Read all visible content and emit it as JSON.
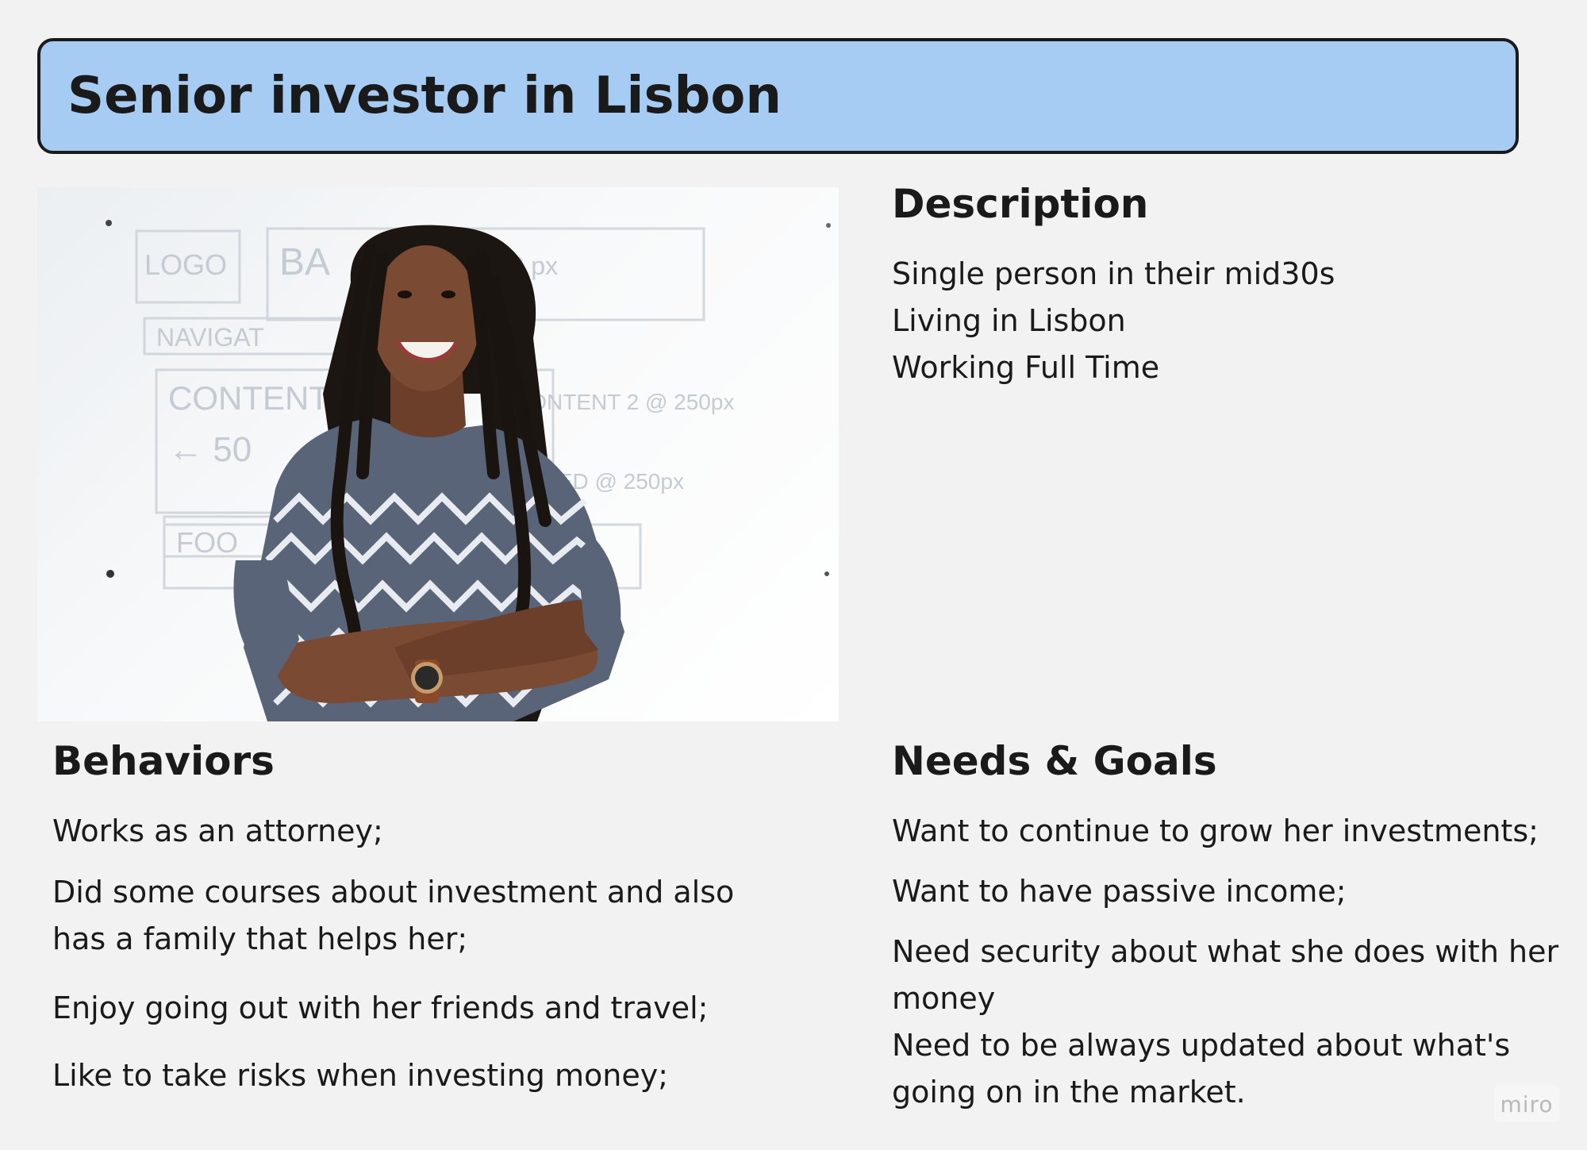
{
  "title": "Senior investor in Lisbon",
  "description": {
    "heading": "Description",
    "lines": [
      "Single person in their mid30s",
      "Living in Lisbon",
      "Working Full Time"
    ]
  },
  "behaviors": {
    "heading": "Behaviors",
    "lines": [
      "Works as an attorney;",
      "Did some courses about investment and also",
      "has a family that helps her;",
      "Enjoy going out with her friends and travel;",
      "Like to take risks when investing money;"
    ]
  },
  "needs_goals": {
    "heading": "Needs & Goals",
    "lines": [
      "Want to continue to grow her investments;",
      "Want to have passive income;",
      "Need security about what she does with her",
      "money",
      "Need to be always updated about what's",
      "going on in the market."
    ]
  },
  "photo_whiteboard_text": [
    "LOGO",
    "BA",
    "500 px",
    "NAVIGAT",
    "CONTENT",
    "CONTENT 2 @ 250px",
    "← 50",
    "FEED @ 250px",
    "FOO"
  ],
  "watermark": "miro"
}
